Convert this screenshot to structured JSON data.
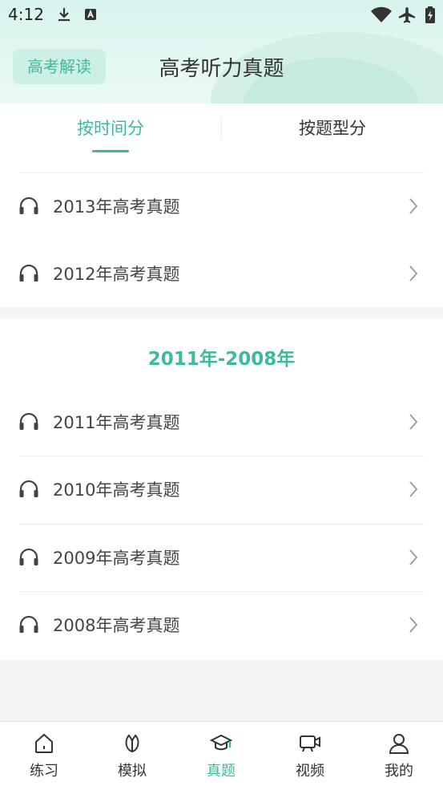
{
  "status_bar": {
    "time": "4:12"
  },
  "header": {
    "badge_label": "高考解读",
    "title": "高考听力真题"
  },
  "tabs": [
    {
      "label": "按时间分",
      "active": true
    },
    {
      "label": "按题型分",
      "active": false
    }
  ],
  "groups": [
    {
      "title": "",
      "items": [
        {
          "label": "2013年高考真题"
        },
        {
          "label": "2012年高考真题"
        }
      ]
    },
    {
      "title": "2011年-2008年",
      "items": [
        {
          "label": "2011年高考真题"
        },
        {
          "label": "2010年高考真题"
        },
        {
          "label": "2009年高考真题"
        },
        {
          "label": "2008年高考真题"
        }
      ]
    }
  ],
  "bottom_nav": [
    {
      "label": "练习",
      "icon": "home-icon",
      "active": false
    },
    {
      "label": "模拟",
      "icon": "leaf-icon",
      "active": false
    },
    {
      "label": "真题",
      "icon": "graduation-cap-icon",
      "active": true
    },
    {
      "label": "视频",
      "icon": "video-icon",
      "active": false
    },
    {
      "label": "我的",
      "icon": "person-icon",
      "active": false
    }
  ],
  "colors": {
    "accent": "#3fb89e",
    "header_bg": "#e4f7f3",
    "page_bg": "#f4f5f6"
  }
}
